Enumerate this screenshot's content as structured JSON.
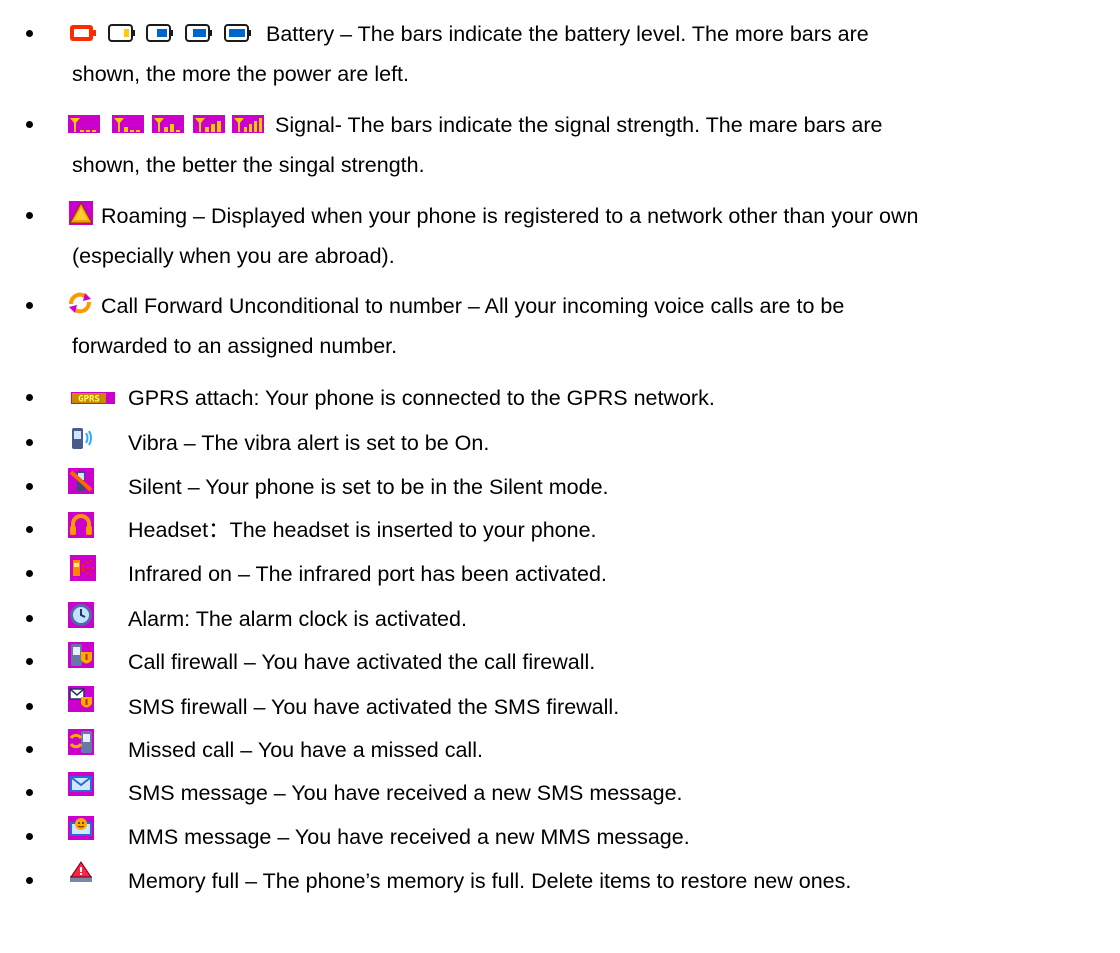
{
  "items": [
    {
      "icon": "battery-icons",
      "lines": [
        "Battery – The bars indicate the battery level. The more bars are",
        "shown, the more the power are left."
      ]
    },
    {
      "icon": "signal-icons",
      "lines": [
        "Signal- The bars indicate the signal strength. The mare bars are",
        "shown, the better the singal strength."
      ]
    },
    {
      "icon": "roaming-icon",
      "lines": [
        "Roaming – Displayed when your phone is registered to a network other than your own",
        "(especially when you are abroad)."
      ]
    },
    {
      "icon": "call-forward-icon",
      "lines": [
        "Call Forward Unconditional to number – All your incoming voice calls are to be",
        "forwarded to an assigned number."
      ]
    },
    {
      "icon": "gprs-icon",
      "lines": [
        "GPRS attach: Your phone is connected to the GPRS network."
      ]
    },
    {
      "icon": "vibra-icon",
      "lines": [
        "Vibra – The vibra alert is set to be On."
      ]
    },
    {
      "icon": "silent-icon",
      "lines": [
        "Silent – Your phone is set to be in the Silent mode."
      ]
    },
    {
      "icon": "headset-icon",
      "lines": [
        "Headset：The headset is inserted to your phone."
      ]
    },
    {
      "icon": "infrared-icon",
      "lines": [
        "Infrared on – The infrared port has been activated."
      ]
    },
    {
      "icon": "alarm-icon",
      "lines": [
        "Alarm: The alarm clock is activated."
      ]
    },
    {
      "icon": "call-firewall-icon",
      "lines": [
        "Call firewall – You have activated the call firewall."
      ]
    },
    {
      "icon": "sms-firewall-icon",
      "lines": [
        "SMS firewall – You have activated the SMS firewall."
      ]
    },
    {
      "icon": "missed-call-icon",
      "lines": [
        "Missed call – You have a missed call."
      ]
    },
    {
      "icon": "sms-message-icon",
      "lines": [
        "SMS message – You have received a new SMS message."
      ]
    },
    {
      "icon": "mms-message-icon",
      "lines": [
        "MMS message – You have received a new MMS message."
      ]
    },
    {
      "icon": "memory-full-icon",
      "lines": [
        "Memory full – The phone’s memory is full. Delete items to restore new ones."
      ]
    }
  ],
  "gprs_icon_text": "GPRS"
}
